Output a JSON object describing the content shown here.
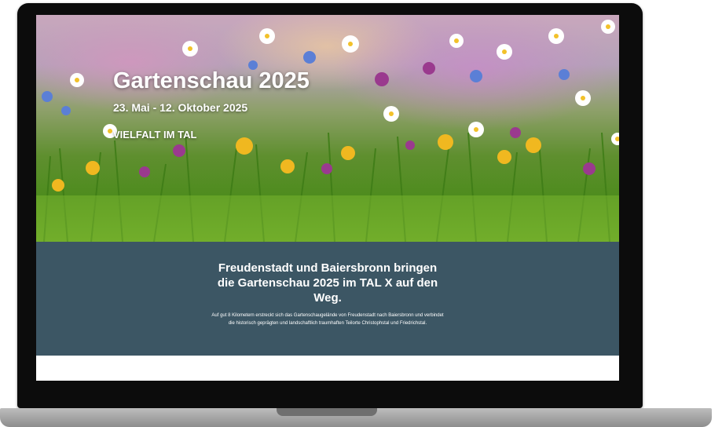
{
  "hero": {
    "title": "Gartenschau 2025",
    "dates": "23. Mai - 12. Oktober 2025",
    "tagline": "VIELFALT IM TAL"
  },
  "intro": {
    "heading": "Freudenstadt und Baiersbronn bringen die Gartenschau 2025 im TAL X auf den Weg.",
    "body": "Auf gut 8 Kilometern erstreckt sich das Gartenschaugelände von Freudenstadt nach Baiersbronn und verbindet die historisch geprägten und landschaftlich traumhaften Teilorte Christophstal und Friedrichstal."
  },
  "colors": {
    "info_band": "#3c5664",
    "bezel": "#0c0c0c",
    "grass": "#4e8c1e"
  }
}
